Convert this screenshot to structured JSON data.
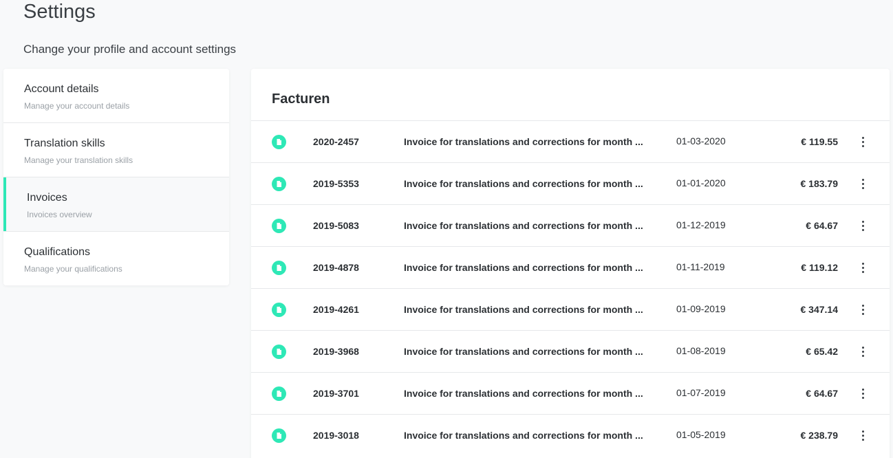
{
  "header": {
    "title": "Settings",
    "subtitle": "Change your profile and account settings"
  },
  "sidebar": {
    "items": [
      {
        "label": "Account details",
        "description": "Manage your account details",
        "active": false
      },
      {
        "label": "Translation skills",
        "description": "Manage your translation skills",
        "active": false
      },
      {
        "label": "Invoices",
        "description": "Invoices overview",
        "active": true
      },
      {
        "label": "Qualifications",
        "description": "Manage your qualifications",
        "active": false
      }
    ]
  },
  "main": {
    "title": "Facturen",
    "invoices": [
      {
        "number": "2020-2457",
        "description": "Invoice for translations and corrections for month ...",
        "date": "01-03-2020",
        "amount": "€ 119.55",
        "icon": "document-icon"
      },
      {
        "number": "2019-5353",
        "description": "Invoice for translations and corrections for month ...",
        "date": "01-01-2020",
        "amount": "€ 183.79",
        "icon": "document-icon"
      },
      {
        "number": "2019-5083",
        "description": "Invoice for translations and corrections for month ...",
        "date": "01-12-2019",
        "amount": "€ 64.67",
        "icon": "document-icon"
      },
      {
        "number": "2019-4878",
        "description": "Invoice for translations and corrections for month ...",
        "date": "01-11-2019",
        "amount": "€ 119.12",
        "icon": "document-icon"
      },
      {
        "number": "2019-4261",
        "description": "Invoice for translations and corrections for month ...",
        "date": "01-09-2019",
        "amount": "€ 347.14",
        "icon": "document-icon"
      },
      {
        "number": "2019-3968",
        "description": "Invoice for translations and corrections for month ...",
        "date": "01-08-2019",
        "amount": "€ 65.42",
        "icon": "document-icon"
      },
      {
        "number": "2019-3701",
        "description": "Invoice for translations and corrections for month ...",
        "date": "01-07-2019",
        "amount": "€ 64.67",
        "icon": "document-icon"
      },
      {
        "number": "2019-3018",
        "description": "Invoice for translations and corrections for month ...",
        "date": "01-05-2019",
        "amount": "€ 238.79",
        "icon": "document-icon"
      }
    ]
  },
  "colors": {
    "accent": "#2ee8b6",
    "background": "#f8f9fa",
    "text": "#2b2f33",
    "muted": "#9aa0a6"
  }
}
